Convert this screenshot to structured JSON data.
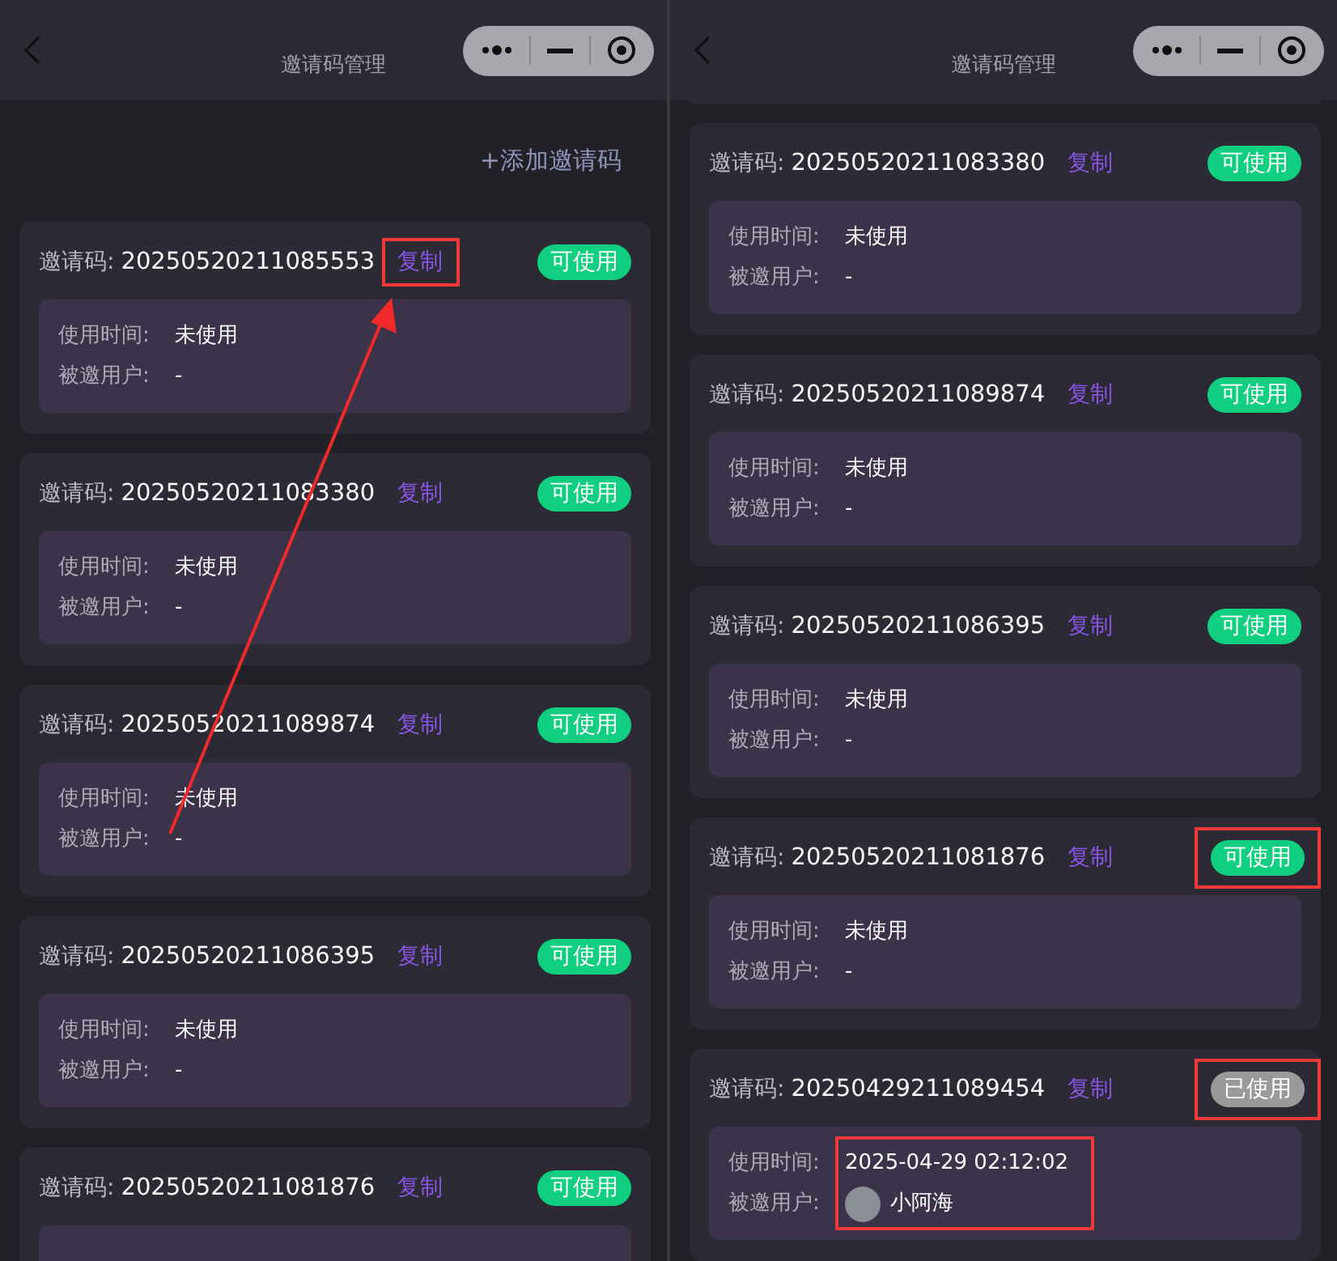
{
  "screens": [
    {
      "title": "邀请码管理",
      "add_button": "+添加邀请码",
      "arrow": true,
      "cards": [
        {
          "label": "邀请码:",
          "code": "20250520211085553",
          "copy": "复制",
          "copy_highlighted": true,
          "status": "可使用",
          "used": false,
          "status_highlighted": false,
          "details": [
            {
              "label": "使用时间:",
              "value": "未使用"
            },
            {
              "label": "被邀用户:",
              "value": "-"
            }
          ],
          "details_highlighted": false
        },
        {
          "label": "邀请码:",
          "code": "20250520211083380",
          "copy": "复制",
          "copy_highlighted": false,
          "status": "可使用",
          "used": false,
          "status_highlighted": false,
          "details": [
            {
              "label": "使用时间:",
              "value": "未使用"
            },
            {
              "label": "被邀用户:",
              "value": "-"
            }
          ],
          "details_highlighted": false
        },
        {
          "label": "邀请码:",
          "code": "20250520211089874",
          "copy": "复制",
          "copy_highlighted": false,
          "status": "可使用",
          "used": false,
          "status_highlighted": false,
          "details": [
            {
              "label": "使用时间:",
              "value": "未使用"
            },
            {
              "label": "被邀用户:",
              "value": "-"
            }
          ],
          "details_highlighted": false
        },
        {
          "label": "邀请码:",
          "code": "20250520211086395",
          "copy": "复制",
          "copy_highlighted": false,
          "status": "可使用",
          "used": false,
          "status_highlighted": false,
          "details": [
            {
              "label": "使用时间:",
              "value": "未使用"
            },
            {
              "label": "被邀用户:",
              "value": "-"
            }
          ],
          "details_highlighted": false
        },
        {
          "label": "邀请码:",
          "code": "20250520211081876",
          "copy": "复制",
          "copy_highlighted": false,
          "status": "可使用",
          "used": false,
          "status_highlighted": false,
          "details_highlighted": false
        }
      ]
    },
    {
      "title": "邀请码管理",
      "top_tail": true,
      "cards": [
        {
          "label": "邀请码:",
          "code": "20250520211083380",
          "copy": "复制",
          "copy_highlighted": false,
          "status": "可使用",
          "used": false,
          "status_highlighted": false,
          "details": [
            {
              "label": "使用时间:",
              "value": "未使用"
            },
            {
              "label": "被邀用户:",
              "value": "-"
            }
          ],
          "details_highlighted": false
        },
        {
          "label": "邀请码:",
          "code": "20250520211089874",
          "copy": "复制",
          "copy_highlighted": false,
          "status": "可使用",
          "used": false,
          "status_highlighted": false,
          "details": [
            {
              "label": "使用时间:",
              "value": "未使用"
            },
            {
              "label": "被邀用户:",
              "value": "-"
            }
          ],
          "details_highlighted": false
        },
        {
          "label": "邀请码:",
          "code": "20250520211086395",
          "copy": "复制",
          "copy_highlighted": false,
          "status": "可使用",
          "used": false,
          "status_highlighted": false,
          "details": [
            {
              "label": "使用时间:",
              "value": "未使用"
            },
            {
              "label": "被邀用户:",
              "value": "-"
            }
          ],
          "details_highlighted": false
        },
        {
          "label": "邀请码:",
          "code": "20250520211081876",
          "copy": "复制",
          "copy_highlighted": false,
          "status": "可使用",
          "used": false,
          "status_highlighted": true,
          "details": [
            {
              "label": "使用时间:",
              "value": "未使用"
            },
            {
              "label": "被邀用户:",
              "value": "-"
            }
          ],
          "details_highlighted": false
        },
        {
          "label": "邀请码:",
          "code": "20250429211089454",
          "copy": "复制",
          "copy_highlighted": false,
          "status": "已使用",
          "used": true,
          "status_highlighted": true,
          "details": [
            {
              "label": "使用时间:",
              "value": "2025-04-29 02:12:02"
            },
            {
              "label": "被邀用户:",
              "value": "小阿海",
              "avatar": true
            }
          ],
          "details_highlighted": true
        }
      ]
    }
  ]
}
